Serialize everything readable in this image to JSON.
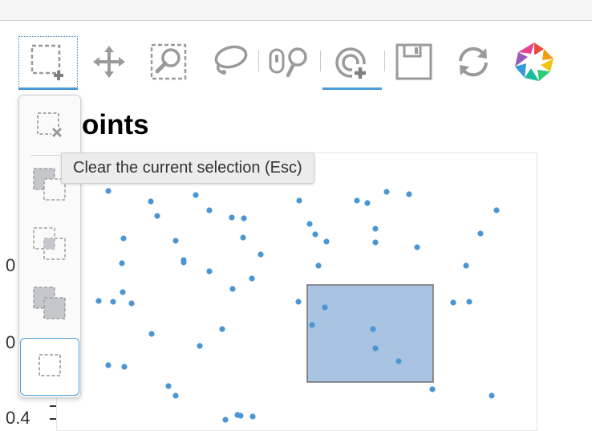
{
  "toolbar": {
    "items": [
      {
        "icon": "add-box-select-icon",
        "state": "focused-active"
      },
      {
        "icon": "pan-icon"
      },
      {
        "icon": "box-zoom-icon"
      },
      {
        "icon": "lasso-select-icon"
      },
      {
        "icon": "wheel-zoom-icon"
      },
      {
        "icon": "tap-select-icon",
        "state": "active"
      },
      {
        "icon": "save-icon"
      },
      {
        "icon": "reset-icon"
      },
      {
        "icon": "bokeh-logo-icon"
      }
    ]
  },
  "selection_menu": {
    "items": [
      {
        "icon": "clear-selection-icon"
      },
      {
        "icon": "replace-selection-icon"
      },
      {
        "icon": "intersect-selection-icon"
      },
      {
        "icon": "append-selection-icon"
      },
      {
        "icon": "empty-selection-icon",
        "state": "active"
      }
    ],
    "tooltip": "Clear the current selection (Esc)"
  },
  "plot": {
    "title_fragment": "oints",
    "y_ticks": [
      "0",
      "0",
      "0.4"
    ],
    "point_color": "#4b96d2",
    "selection_fill": "#a9c4e2",
    "selection_stroke": "#6e6e6e",
    "accent": "#4a9fd8"
  }
}
